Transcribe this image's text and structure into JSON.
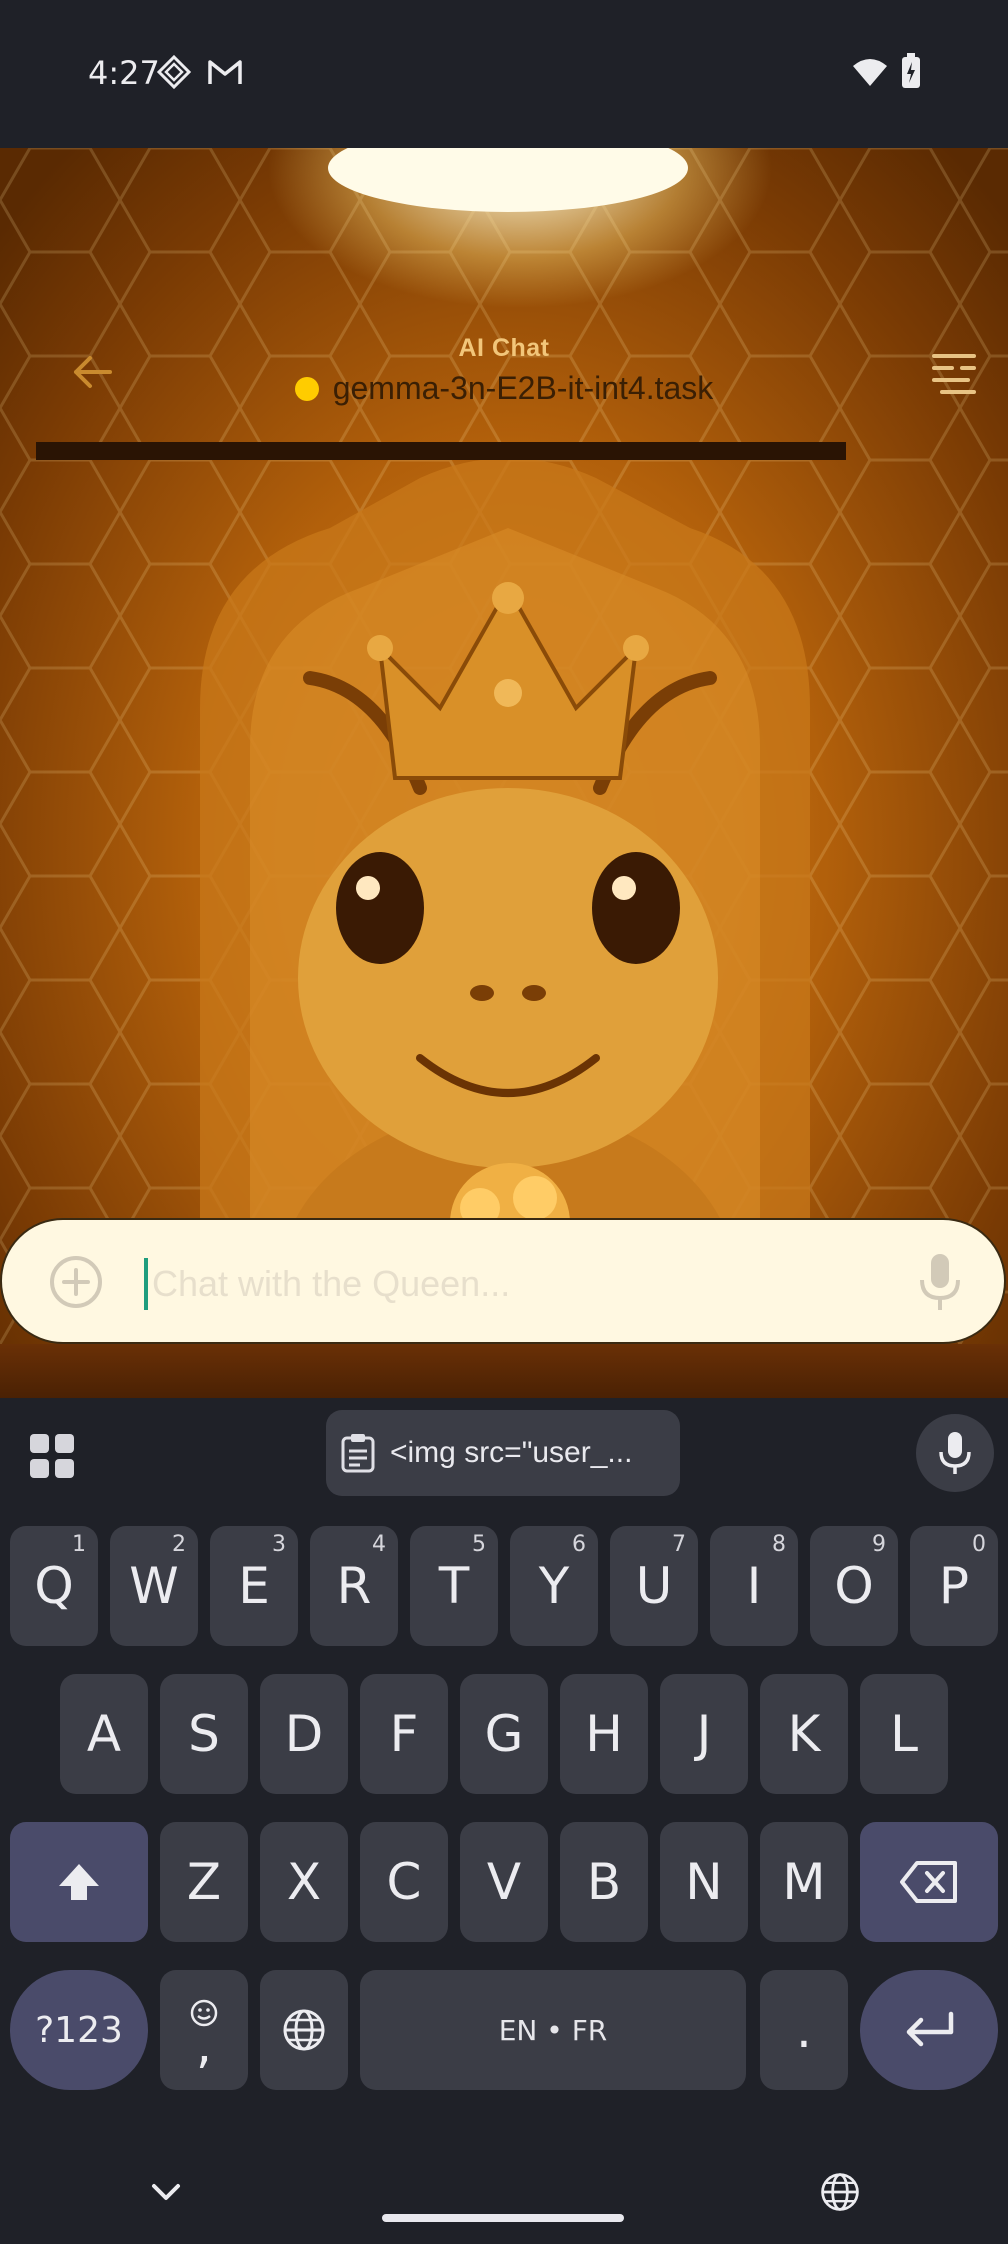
{
  "status_bar": {
    "time": "4:27",
    "icons": [
      "vpn-diamond-icon",
      "gmail-icon",
      "wifi-icon",
      "battery-charging-icon"
    ]
  },
  "app_bar": {
    "small_title": "AI Chat",
    "model_name": "gemma-3n-E2B-it-int4.task",
    "model_status_color": "#ffcc00",
    "back_icon": "arrow-back-icon",
    "tune_icon": "tune-settings-icon"
  },
  "chat_input": {
    "placeholder": "Chat with the Queen...",
    "value": "",
    "add_icon": "add-circle-icon",
    "mic_icon": "microphone-icon"
  },
  "keyboard": {
    "clipboard_chip": "<img src=\"user_...",
    "row1": [
      {
        "label": "Q",
        "hint": "1"
      },
      {
        "label": "W",
        "hint": "2"
      },
      {
        "label": "E",
        "hint": "3"
      },
      {
        "label": "R",
        "hint": "4"
      },
      {
        "label": "T",
        "hint": "5"
      },
      {
        "label": "Y",
        "hint": "6"
      },
      {
        "label": "U",
        "hint": "7"
      },
      {
        "label": "I",
        "hint": "8"
      },
      {
        "label": "O",
        "hint": "9"
      },
      {
        "label": "P",
        "hint": "0"
      }
    ],
    "row2": [
      "A",
      "S",
      "D",
      "F",
      "G",
      "H",
      "J",
      "K",
      "L"
    ],
    "row3": [
      "Z",
      "X",
      "C",
      "V",
      "B",
      "N",
      "M"
    ],
    "symbols_label": "?123",
    "comma_label": ",",
    "space_label": "EN • FR",
    "period_label": ".",
    "accent_color": "#4a4b6a"
  }
}
